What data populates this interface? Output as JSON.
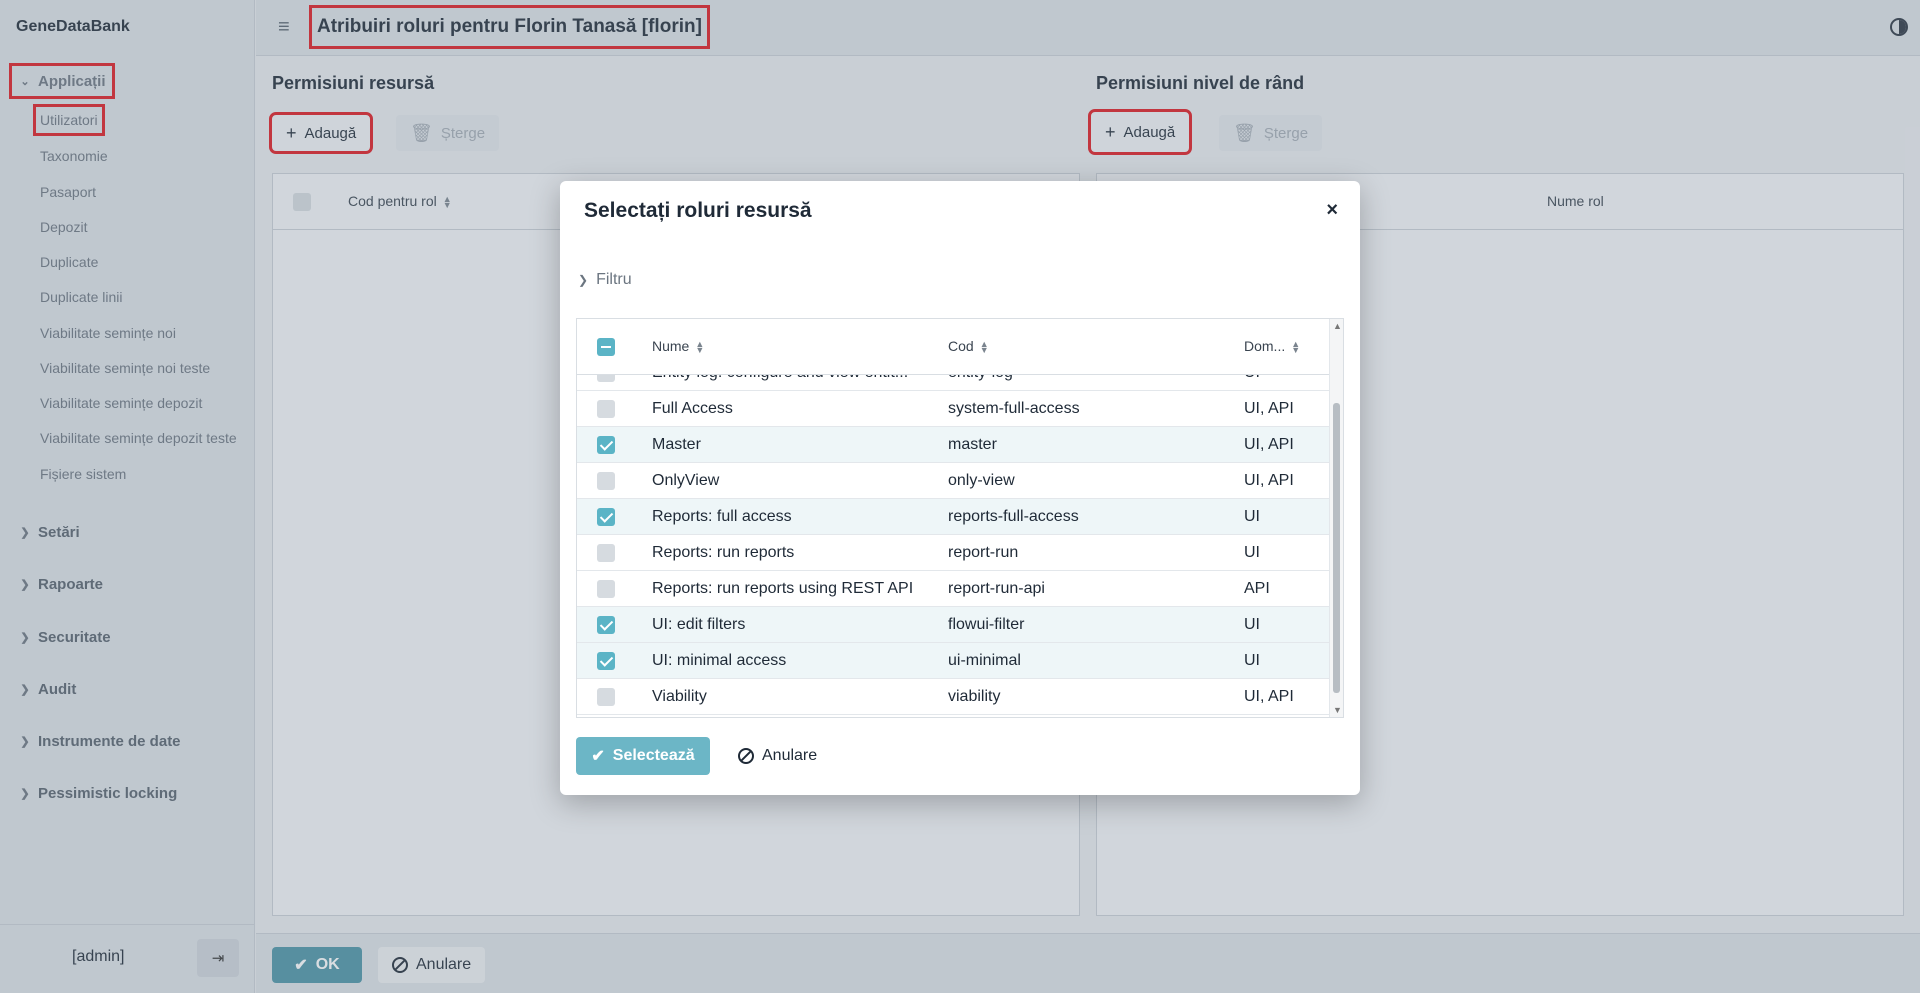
{
  "app": {
    "brand": "GeneDataBank",
    "title": "Atribuiri roluri pentru Florin Tanasă [florin]"
  },
  "sidebar": {
    "open_group": "Applicații",
    "items": [
      "Utilizatori",
      "Taxonomie",
      "Pasaport",
      "Depozit",
      "Duplicate",
      "Duplicate linii",
      "Viabilitate semințe noi",
      "Viabilitate semințe noi teste",
      "Viabilitate semințe depozit",
      "Viabilitate semințe depozit teste",
      "Fișiere sistem"
    ],
    "groups": [
      "Setări",
      "Rapoarte",
      "Securitate",
      "Audit",
      "Instrumente de date",
      "Pessimistic locking"
    ],
    "user": "[admin]"
  },
  "left_panel": {
    "title": "Permisiuni resursă",
    "add_label": "Adaugă",
    "delete_label": "Șterge",
    "column": "Cod pentru rol"
  },
  "right_panel": {
    "title": "Permisiuni nivel de rând",
    "add_label": "Adaugă",
    "delete_label": "Șterge",
    "column": "Nume rol"
  },
  "footer": {
    "ok_label": "OK",
    "cancel_label": "Anulare"
  },
  "dialog": {
    "title": "Selectați roluri resursă",
    "close": "×",
    "filter_label": "Filtru",
    "columns": {
      "name": "Nume",
      "code": "Cod",
      "domain": "Dom..."
    },
    "rows": [
      {
        "name": "Entity log: configure and view entit...",
        "code": "entity-log",
        "domain": "UI",
        "checked": false
      },
      {
        "name": "Full Access",
        "code": "system-full-access",
        "domain": "UI, API",
        "checked": false
      },
      {
        "name": "Master",
        "code": "master",
        "domain": "UI, API",
        "checked": true
      },
      {
        "name": "OnlyView",
        "code": "only-view",
        "domain": "UI, API",
        "checked": false
      },
      {
        "name": "Reports: full access",
        "code": "reports-full-access",
        "domain": "UI",
        "checked": true
      },
      {
        "name": "Reports: run reports",
        "code": "report-run",
        "domain": "UI",
        "checked": false
      },
      {
        "name": "Reports: run reports using REST API",
        "code": "report-run-api",
        "domain": "API",
        "checked": false
      },
      {
        "name": "UI: edit filters",
        "code": "flowui-filter",
        "domain": "UI",
        "checked": true
      },
      {
        "name": "UI: minimal access",
        "code": "ui-minimal",
        "domain": "UI",
        "checked": true
      },
      {
        "name": "Viability",
        "code": "viability",
        "domain": "UI, API",
        "checked": false
      }
    ],
    "select_label": "Selectează",
    "cancel_label": "Anulare"
  },
  "colors": {
    "accent": "#5bb4c6",
    "ok": "#4c94a6",
    "highlight": "#e0181f"
  }
}
